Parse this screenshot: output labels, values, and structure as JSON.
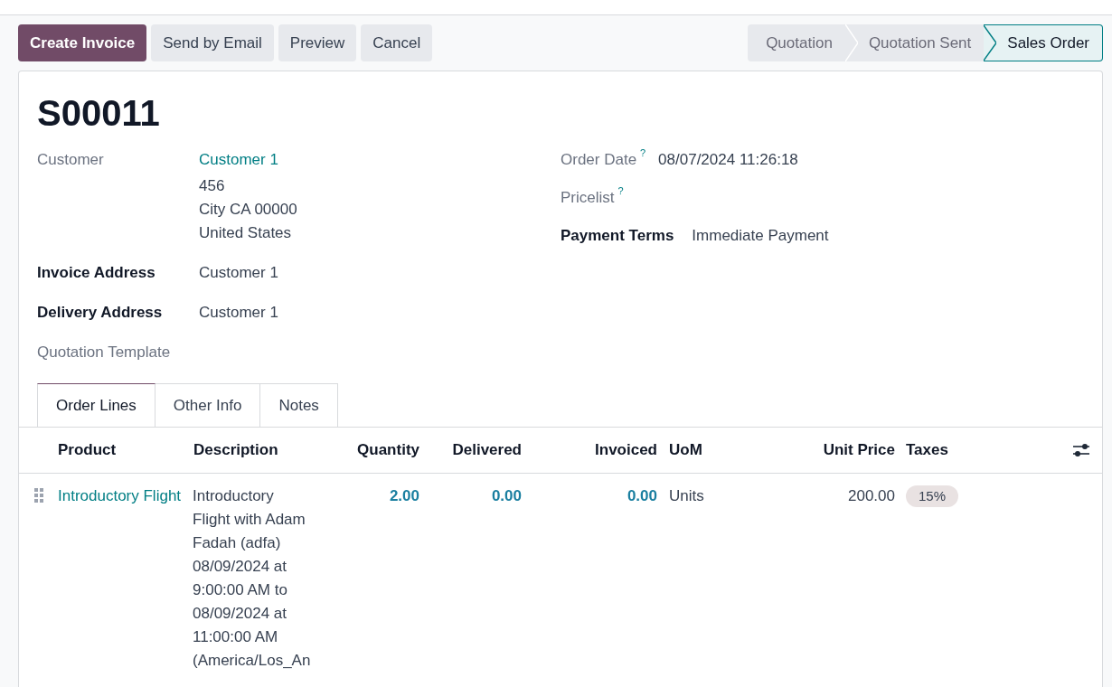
{
  "actions": [
    {
      "label": "Create Invoice",
      "primary": true
    },
    {
      "label": "Send by Email",
      "primary": false
    },
    {
      "label": "Preview",
      "primary": false
    },
    {
      "label": "Cancel",
      "primary": false
    }
  ],
  "stages": [
    {
      "label": "Quotation",
      "selected": false
    },
    {
      "label": "Quotation Sent",
      "selected": false
    },
    {
      "label": "Sales Order",
      "selected": true
    }
  ],
  "title": "S00011",
  "customer": {
    "label": "Customer",
    "name": "Customer 1",
    "address": [
      "456",
      "City CA 00000",
      "United States"
    ]
  },
  "left_fields": [
    {
      "label": "Invoice Address",
      "value": "Customer 1",
      "required": true
    },
    {
      "label": "Delivery Address",
      "value": "Customer 1",
      "required": true
    },
    {
      "label": "Quotation Template",
      "required": false
    }
  ],
  "right_fields": [
    {
      "label": "Order Date",
      "help": "?",
      "value": "08/07/2024 11:26:18",
      "required": false
    },
    {
      "label": "Pricelist",
      "help": "?",
      "required": false
    },
    {
      "label": "Payment Terms",
      "value": "Immediate Payment",
      "required": true
    }
  ],
  "tabs": [
    {
      "label": "Order Lines",
      "selected": true
    },
    {
      "label": "Other Info",
      "selected": false
    },
    {
      "label": "Notes",
      "selected": false
    }
  ],
  "table": {
    "columns": {
      "product": "Product",
      "description": "Description",
      "quantity": "Quantity",
      "delivered": "Delivered",
      "invoiced": "Invoiced",
      "uom": "UoM",
      "unit_price": "Unit Price",
      "taxes": "Taxes"
    },
    "rows": [
      {
        "product": "Introductory Flight",
        "description": "Introductory Flight with Adam Fadah (adfa) 08/09/2024 at 9:00:00 AM to 08/09/2024 at 11:00:00 AM (America/Los_An",
        "quantity": "2.00",
        "delivered": "0.00",
        "invoiced": "0.00",
        "uom": "Units",
        "unit_price": "200.00",
        "taxes": [
          "15%"
        ]
      }
    ]
  }
}
